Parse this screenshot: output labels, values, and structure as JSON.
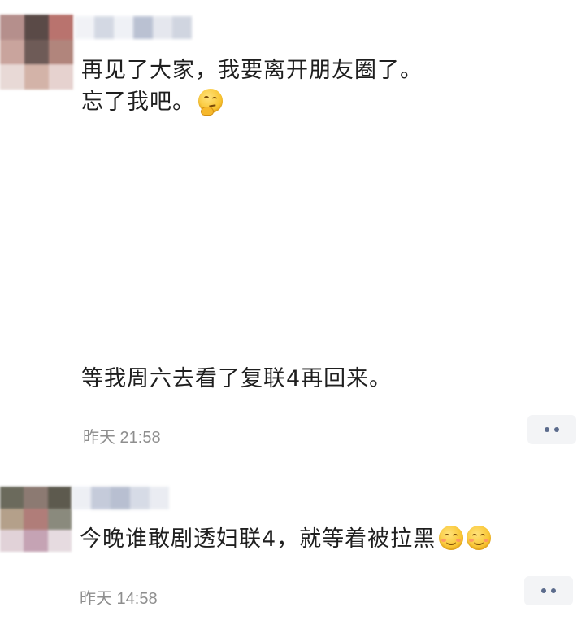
{
  "posts": [
    {
      "lines": [
        "再见了大家，我要离开朋友圈了。",
        "忘了我吧。",
        "等我周六去看了复联4再回来。"
      ],
      "emoji_line2": "thinking-face-icon",
      "timestamp": "昨天 21:58"
    },
    {
      "lines": [
        "今晚谁敢剧透妇联4，就等着被拉黑"
      ],
      "emojis": [
        "smiling-face-icon",
        "smiling-face-icon"
      ],
      "timestamp": "昨天 14:58"
    }
  ],
  "colors": {
    "text": "#1f1f1f",
    "timestamp": "#8e8e8e",
    "more_button_bg": "#f3f4f6",
    "more_button_dots": "#5b6b8c"
  }
}
